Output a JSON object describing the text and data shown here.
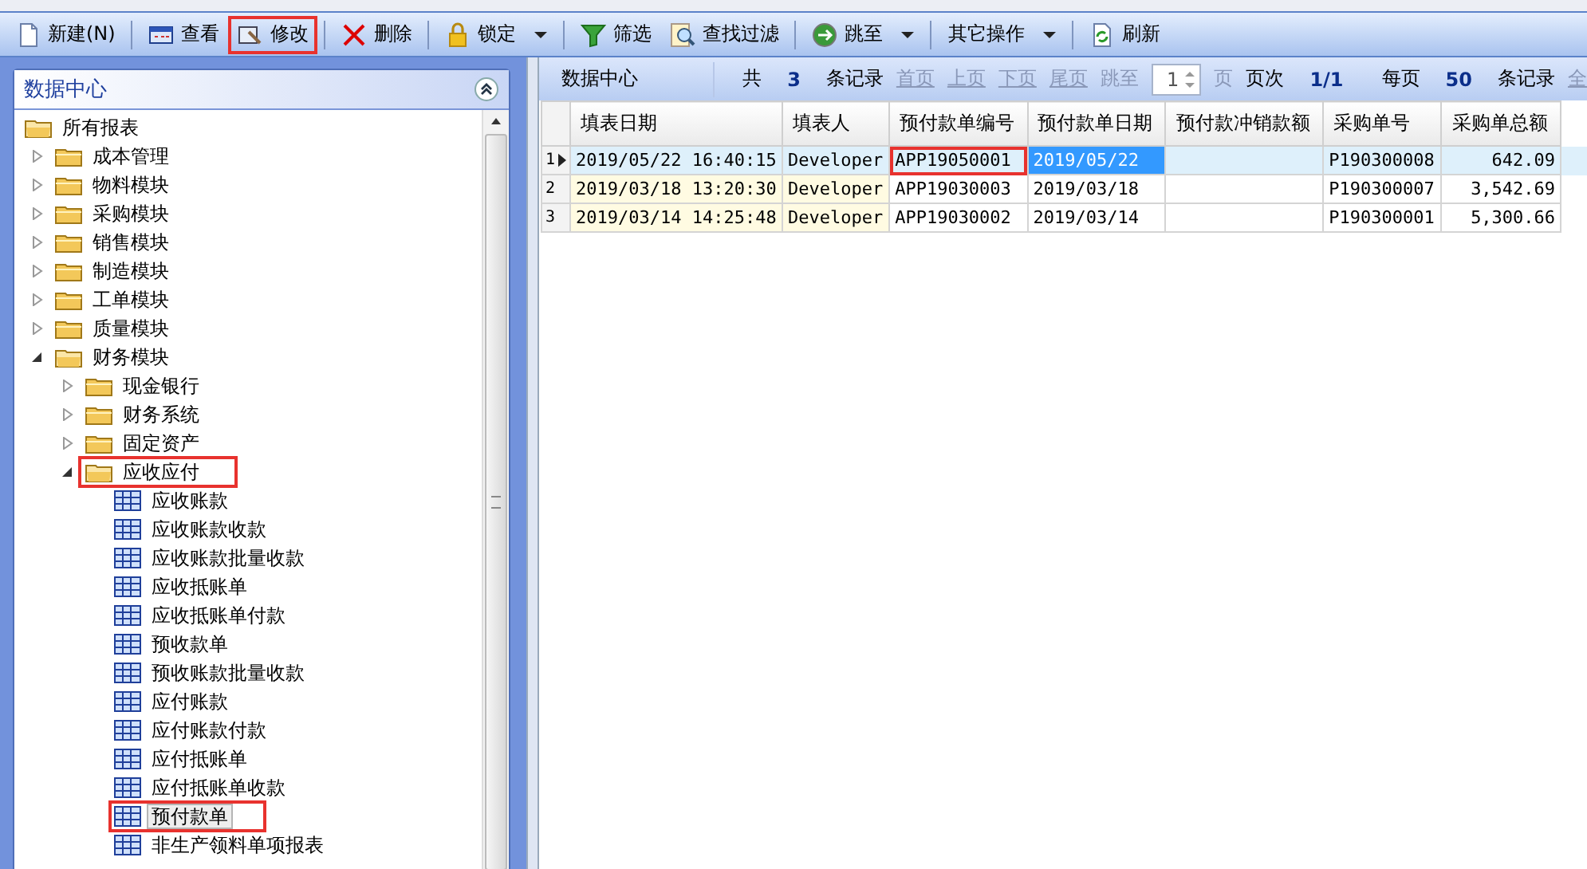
{
  "toolbar": [
    [
      {
        "label": "新建(N)",
        "kind": "new",
        "dropdown": false,
        "highlighted": false
      }
    ],
    [
      {
        "label": "查看",
        "kind": "view",
        "dropdown": false,
        "highlighted": false
      },
      {
        "label": "修改",
        "kind": "edit",
        "dropdown": false,
        "highlighted": true
      }
    ],
    [
      {
        "label": "删除",
        "kind": "delete",
        "dropdown": false,
        "highlighted": false
      }
    ],
    [
      {
        "label": "锁定",
        "kind": "lock",
        "dropdown": true,
        "highlighted": false
      }
    ],
    [
      {
        "label": "筛选",
        "kind": "filter",
        "dropdown": false,
        "highlighted": false
      },
      {
        "label": "查找过滤",
        "kind": "find",
        "dropdown": false,
        "highlighted": false
      }
    ],
    [
      {
        "label": "跳至",
        "kind": "goto",
        "dropdown": true,
        "highlighted": false
      }
    ],
    [
      {
        "label": "其它操作",
        "kind": "plain",
        "dropdown": true,
        "highlighted": false
      }
    ],
    [
      {
        "label": "刷新",
        "kind": "refresh",
        "dropdown": false,
        "highlighted": false
      }
    ]
  ],
  "sidebar": {
    "title": "数据中心",
    "tree": [
      {
        "label": "所有报表",
        "kind": "folder",
        "expanded": true,
        "selected": false,
        "highlighted": false,
        "children": [
          {
            "label": "成本管理",
            "kind": "folder",
            "expanded": false,
            "selected": false,
            "highlighted": false
          },
          {
            "label": "物料模块",
            "kind": "folder",
            "expanded": false,
            "selected": false,
            "highlighted": false
          },
          {
            "label": "采购模块",
            "kind": "folder",
            "expanded": false,
            "selected": false,
            "highlighted": false
          },
          {
            "label": "销售模块",
            "kind": "folder",
            "expanded": false,
            "selected": false,
            "highlighted": false
          },
          {
            "label": "制造模块",
            "kind": "folder",
            "expanded": false,
            "selected": false,
            "highlighted": false
          },
          {
            "label": "工单模块",
            "kind": "folder",
            "expanded": false,
            "selected": false,
            "highlighted": false
          },
          {
            "label": "质量模块",
            "kind": "folder",
            "expanded": false,
            "selected": false,
            "highlighted": false
          },
          {
            "label": "财务模块",
            "kind": "folder",
            "expanded": true,
            "selected": false,
            "highlighted": false,
            "children": [
              {
                "label": "现金银行",
                "kind": "folder",
                "expanded": false,
                "selected": false,
                "highlighted": false
              },
              {
                "label": "财务系统",
                "kind": "folder",
                "expanded": false,
                "selected": false,
                "highlighted": false
              },
              {
                "label": "固定资产",
                "kind": "folder",
                "expanded": false,
                "selected": false,
                "highlighted": false
              },
              {
                "label": "应收应付",
                "kind": "folder",
                "expanded": true,
                "selected": false,
                "highlighted": true,
                "children": [
                  {
                    "label": "应收账款",
                    "kind": "report",
                    "selected": false,
                    "highlighted": false
                  },
                  {
                    "label": "应收账款收款",
                    "kind": "report",
                    "selected": false,
                    "highlighted": false
                  },
                  {
                    "label": "应收账款批量收款",
                    "kind": "report",
                    "selected": false,
                    "highlighted": false
                  },
                  {
                    "label": "应收抵账单",
                    "kind": "report",
                    "selected": false,
                    "highlighted": false
                  },
                  {
                    "label": "应收抵账单付款",
                    "kind": "report",
                    "selected": false,
                    "highlighted": false
                  },
                  {
                    "label": "预收款单",
                    "kind": "report",
                    "selected": false,
                    "highlighted": false
                  },
                  {
                    "label": "预收账款批量收款",
                    "kind": "report",
                    "selected": false,
                    "highlighted": false
                  },
                  {
                    "label": "应付账款",
                    "kind": "report",
                    "selected": false,
                    "highlighted": false
                  },
                  {
                    "label": "应付账款付款",
                    "kind": "report",
                    "selected": false,
                    "highlighted": false
                  },
                  {
                    "label": "应付抵账单",
                    "kind": "report",
                    "selected": false,
                    "highlighted": false
                  },
                  {
                    "label": "应付抵账单收款",
                    "kind": "report",
                    "selected": false,
                    "highlighted": false
                  },
                  {
                    "label": "预付款单",
                    "kind": "report",
                    "selected": true,
                    "highlighted": true
                  },
                  {
                    "label": "非生产领料单项报表",
                    "kind": "report",
                    "selected": false,
                    "highlighted": false
                  }
                ]
              }
            ]
          }
        ]
      }
    ]
  },
  "pager": {
    "title": "数据中心",
    "total_prefix": "共",
    "total": "3",
    "total_suffix": "条记录",
    "links": [
      {
        "label": "首页",
        "disabled": true
      },
      {
        "label": "上页",
        "disabled": true
      },
      {
        "label": "下页",
        "disabled": true
      },
      {
        "label": "尾页",
        "disabled": true
      }
    ],
    "goto_label": "跳至",
    "page_value": "1",
    "page_suffix": "页",
    "page_prefix": "页次",
    "page": "1/1",
    "per_page_prefix": "每页",
    "per_page": "50",
    "per_page_suffix": "条记录",
    "all": "全"
  },
  "table": {
    "columns": [
      {
        "label": "填表日期",
        "shaded": true,
        "numeric": false
      },
      {
        "label": "填表人",
        "shaded": true,
        "numeric": false
      },
      {
        "label": "预付款单编号",
        "shaded": false,
        "numeric": false
      },
      {
        "label": "预付款单日期",
        "shaded": false,
        "numeric": false
      },
      {
        "label": "预付款冲销款额",
        "shaded": false
      },
      {
        "label": "采购单号",
        "shaded": false,
        "numeric": false
      },
      {
        "label": "采购单总额",
        "shaded": false,
        "numeric": true
      }
    ],
    "rows": [
      {
        "number": "1",
        "selected": true,
        "cells": [
          {
            "text": "2019/05/22 16:40:15",
            "selected": false,
            "highlighted": false
          },
          {
            "text": "Developer",
            "selected": false,
            "highlighted": false
          },
          {
            "text": "APP19050001",
            "selected": false,
            "highlighted": true
          },
          {
            "text": "2019/05/22",
            "selected": true,
            "highlighted": false
          },
          {
            "selected": false,
            "highlighted": false
          },
          {
            "text": "P190300008",
            "selected": false,
            "highlighted": false
          },
          {
            "text": "642.09",
            "selected": false,
            "highlighted": false
          }
        ]
      },
      {
        "number": "2",
        "selected": false,
        "cells": [
          {
            "text": "2019/03/18 13:20:30",
            "selected": false,
            "highlighted": false
          },
          {
            "text": "Developer",
            "selected": false,
            "highlighted": false
          },
          {
            "text": "APP19030003",
            "selected": false,
            "highlighted": false
          },
          {
            "text": "2019/03/18",
            "selected": false,
            "highlighted": false
          },
          {
            "selected": false,
            "highlighted": false
          },
          {
            "text": "P190300007",
            "selected": false,
            "highlighted": false
          },
          {
            "text": "3,542.69",
            "selected": false,
            "highlighted": false
          }
        ]
      },
      {
        "number": "3",
        "selected": false,
        "cells": [
          {
            "text": "2019/03/14 14:25:48",
            "selected": false,
            "highlighted": false
          },
          {
            "text": "Developer",
            "selected": false,
            "highlighted": false
          },
          {
            "text": "APP19030002",
            "selected": false,
            "highlighted": false
          },
          {
            "text": "2019/03/14",
            "selected": false,
            "highlighted": false
          },
          {
            "selected": false,
            "highlighted": false
          },
          {
            "text": "P190300001",
            "selected": false,
            "highlighted": false
          },
          {
            "text": "5,300.66",
            "selected": false,
            "highlighted": false
          }
        ]
      }
    ]
  }
}
